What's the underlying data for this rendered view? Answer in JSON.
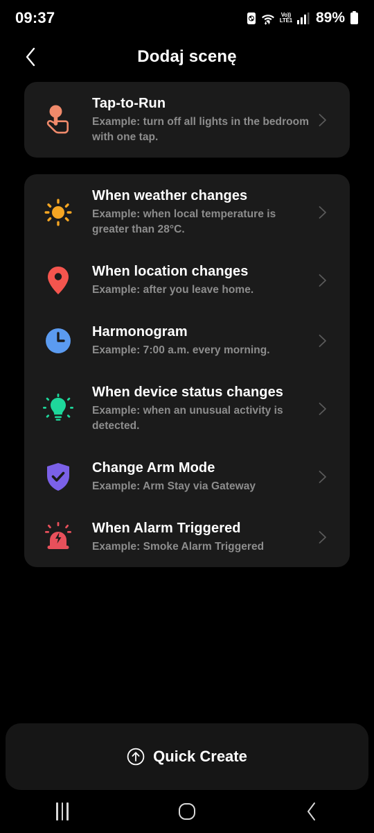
{
  "status_bar": {
    "time": "09:37",
    "battery_percent": "89%",
    "network_label": "Vo))",
    "network_sub": "LTE1",
    "icons": [
      "alarm-battery-icon",
      "wifi-icon",
      "volte-icon",
      "signal-bars-icon",
      "battery-icon"
    ]
  },
  "app_bar": {
    "title": "Dodaj scenę",
    "back_icon": "chevron-left-icon"
  },
  "cards": [
    {
      "id": "tap-to-run-card",
      "rows": [
        {
          "id": "tap-to-run",
          "icon": "hand-tap-icon",
          "color": "#F08A6B",
          "title": "Tap-to-Run",
          "subtitle": "Example: turn off all lights in the bedroom with one tap."
        }
      ]
    },
    {
      "id": "automations-card",
      "rows": [
        {
          "id": "when-weather-changes",
          "icon": "sun-icon",
          "color": "#F5A623",
          "title": "When weather changes",
          "subtitle": "Example: when local temperature is greater than 28°C."
        },
        {
          "id": "when-location-changes",
          "icon": "location-pin-icon",
          "color": "#F4554E",
          "title": "When location changes",
          "subtitle": "Example: after you leave home."
        },
        {
          "id": "harmonogram",
          "icon": "clock-icon",
          "color": "#5B9BF0",
          "title": "Harmonogram",
          "subtitle": "Example: 7:00 a.m. every morning."
        },
        {
          "id": "when-device-status-changes",
          "icon": "lightbulb-icon",
          "color": "#1ED79B",
          "title": "When device status changes",
          "subtitle": "Example: when an unusual activity is detected."
        },
        {
          "id": "change-arm-mode",
          "icon": "shield-check-icon",
          "color": "#7B61E8",
          "title": "Change Arm Mode",
          "subtitle": "Example: Arm Stay via Gateway"
        },
        {
          "id": "when-alarm-triggered",
          "icon": "siren-icon",
          "color": "#E8505B",
          "title": "When Alarm Triggered",
          "subtitle": "Example: Smoke Alarm Triggered"
        }
      ]
    }
  ],
  "quick_create": {
    "label": "Quick Create",
    "icon": "arrow-up-circle-icon"
  },
  "nav_bar": {
    "recents_label": "recents-icon",
    "home_label": "home-icon",
    "back_label": "back-icon"
  },
  "colors": {
    "page_background": "#000000",
    "card_background": "#1b1b1b",
    "title_text": "#ffffff",
    "subtitle_text": "#8d8d8d",
    "chevron": "#5a5a5a"
  }
}
